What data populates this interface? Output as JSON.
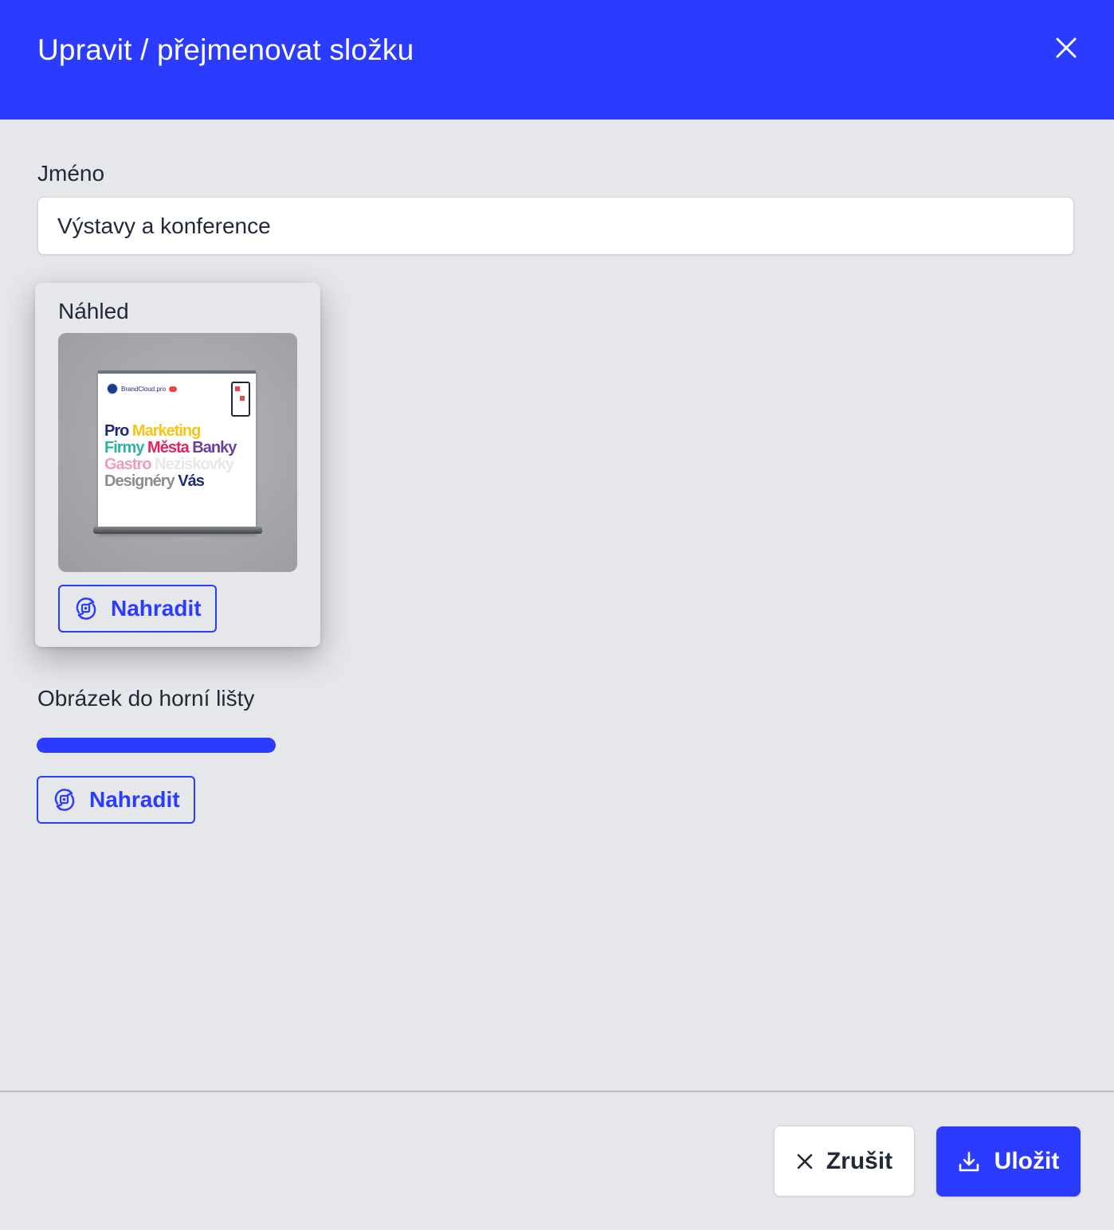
{
  "dialog": {
    "title": "Upravit / přejmenovat složku"
  },
  "name_field": {
    "label": "Jméno",
    "value": "Výstavy a konference"
  },
  "preview": {
    "label": "Náhled",
    "replace_label": "Nahradit",
    "banner": {
      "logo_text": "BrandCloud.pro",
      "lines": [
        [
          {
            "text": "Pro",
            "color": "#1e2a78"
          },
          {
            "text": "Marketing",
            "color": "#f5c518"
          }
        ],
        [
          {
            "text": "Firmy",
            "color": "#2bb3a3"
          },
          {
            "text": "Města",
            "color": "#e0245e"
          },
          {
            "text": "Banky",
            "color": "#6b3fa0"
          }
        ],
        [
          {
            "text": "Gastro",
            "color": "#f19bbd"
          },
          {
            "text": "Neziskovky",
            "color": "#e5e7eb"
          }
        ],
        [
          {
            "text": "Designéry",
            "color": "#8a8d92"
          },
          {
            "text": "Vás",
            "color": "#1e2a78"
          }
        ]
      ]
    }
  },
  "top_bar_image": {
    "label": "Obrázek do horní lišty",
    "replace_label": "Nahradit"
  },
  "footer": {
    "cancel_label": "Zrušit",
    "save_label": "Uložit"
  },
  "colors": {
    "accent": "#2b3bff",
    "background": "#e5e7eb"
  },
  "icons": {
    "close": "close-icon",
    "replace": "replace-icon",
    "cancel": "x-icon",
    "save": "download-icon"
  }
}
